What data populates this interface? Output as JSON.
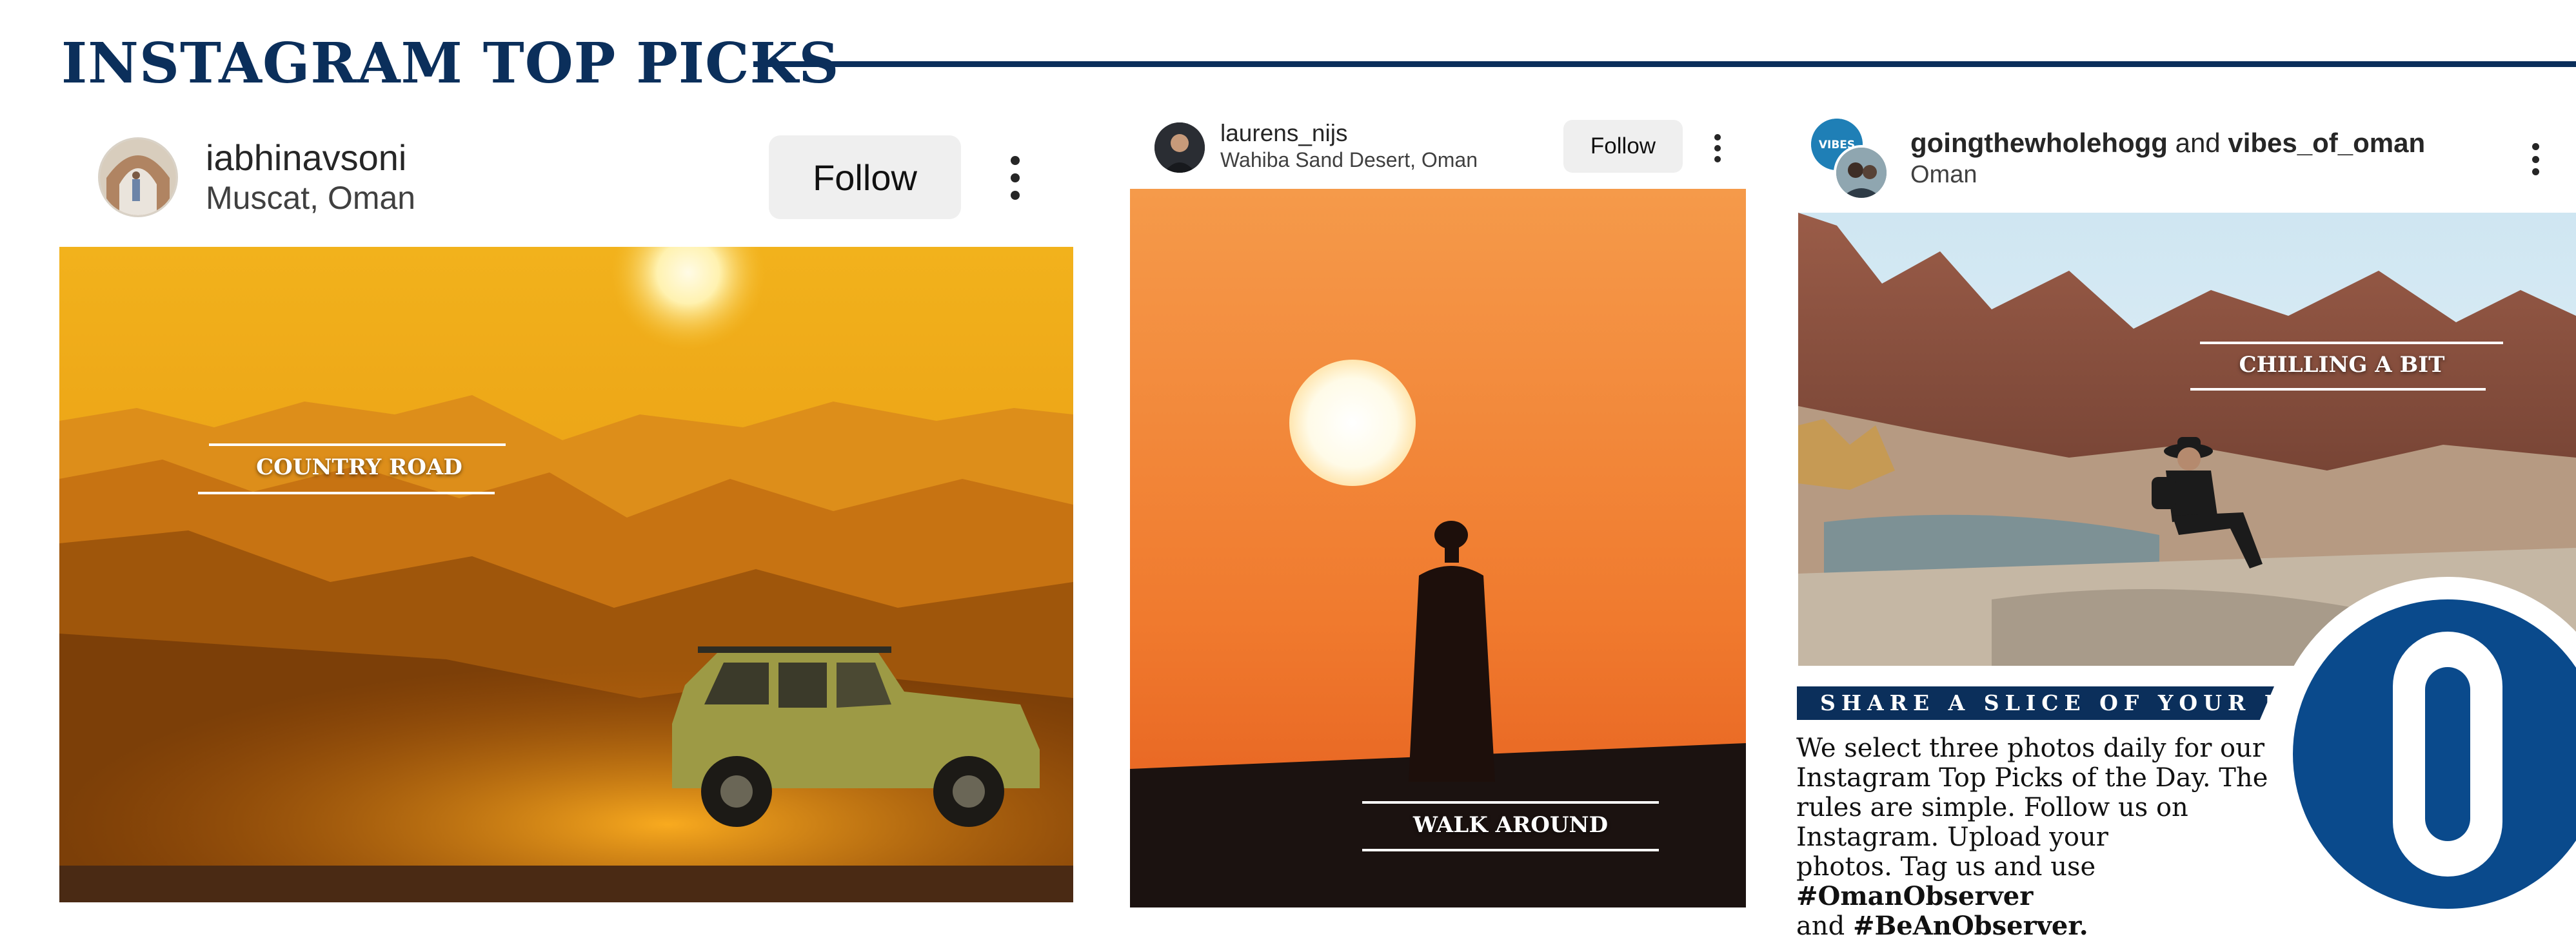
{
  "section": {
    "title": "INSTAGRAM TOP PICKS"
  },
  "posts": [
    {
      "username": "iabhinavsoni",
      "location": "Muscat, Oman",
      "follow_label": "Follow",
      "caption": "COUNTRY ROAD"
    },
    {
      "username": "laurens_nijs",
      "location": "Wahiba Sand Desert, Oman",
      "follow_label": "Follow",
      "caption": "WALK AROUND"
    },
    {
      "username": "goingthewholehogg",
      "and_text": "and",
      "collab_username": "vibes_of_oman",
      "location": "Oman",
      "caption": "CHILLING A BIT",
      "avatar_badge": "VIBES"
    }
  ],
  "info": {
    "banner": "SHARE A SLICE OF YOUR LIFE",
    "body_1": "We select three photos daily for our",
    "body_2": "Instagram Top Picks of the Day. The",
    "body_3": "rules are simple. Follow us on",
    "body_4": "Instagram. Upload your",
    "body_5a": "photos. Tag us and use ",
    "hashtag_1": "#OmanObserver",
    "body_6a": "and ",
    "hashtag_2": "#BeAnObserver.",
    "logo_letter": "O"
  },
  "colors": {
    "brand_navy": "#0b2f5b",
    "logo_blue": "#0a4a8c",
    "follow_bg": "#efefef"
  },
  "icons": [
    "more-vertical-icon",
    "avatar-icon",
    "observer-logo-icon"
  ]
}
